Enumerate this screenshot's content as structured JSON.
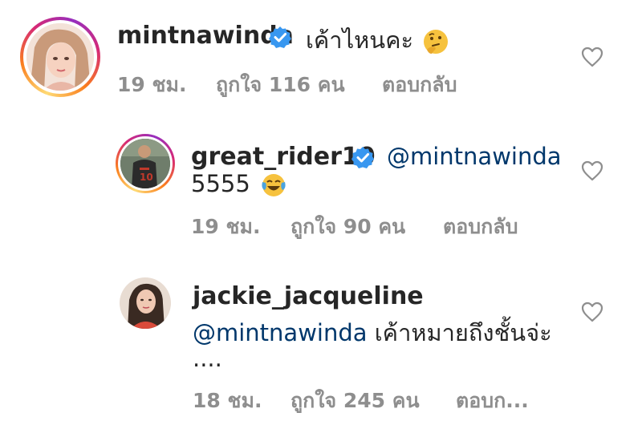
{
  "comments": [
    {
      "username": "mintnawinda",
      "verified": true,
      "text": "เค้าไหนคะ",
      "emoji": "thinking-face",
      "time": "19 ชม.",
      "likes": "ถูกใจ 116 คน",
      "reply": "ตอบกลับ"
    },
    {
      "username": "great_rider10",
      "verified": true,
      "mention": "@mintnawinda",
      "text": "5555",
      "emoji": "face-with-tears-of-joy",
      "time": "19 ชม.",
      "likes": "ถูกใจ 90 คน",
      "reply": "ตอบกลับ"
    },
    {
      "username": "jackie_jacqueline",
      "verified": false,
      "mention": "@mintnawinda",
      "text": " เค้าหมายถึงชั้นจ่ะ",
      "text_line2": "....",
      "time": "18 ชม.",
      "likes": "ถูกใจ 245 คน",
      "reply": "ตอบก..."
    }
  ],
  "colors": {
    "text": "#262626",
    "meta": "#8e8e8e",
    "mention": "#00376b",
    "verified": "#3897f0"
  }
}
